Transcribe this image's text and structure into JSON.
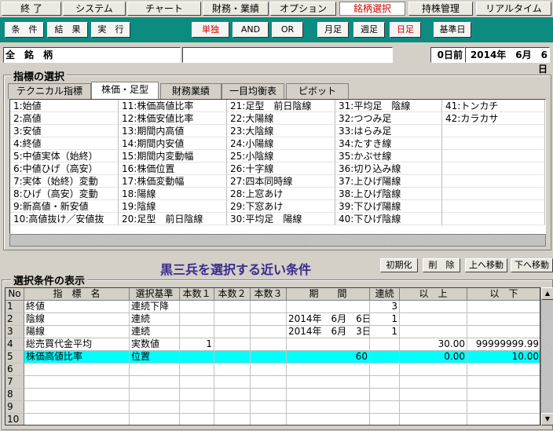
{
  "menu": [
    {
      "label": "終 了",
      "active": false
    },
    {
      "label": "システム",
      "active": false
    },
    {
      "label": "チャート",
      "active": false
    },
    {
      "label": "財務・業績",
      "active": false
    },
    {
      "label": "オプション",
      "active": false
    },
    {
      "label": "銘柄選択",
      "active": true
    },
    {
      "label": "持株管理",
      "active": false
    },
    {
      "label": "リアルタイム",
      "active": false
    }
  ],
  "toolbar": {
    "buttons": [
      "条　件",
      "結　果",
      "実　行",
      "単独",
      "AND",
      "OR",
      "月足",
      "週足",
      "日足",
      "基準日"
    ],
    "red": [
      "単独",
      "日足"
    ]
  },
  "header": {
    "title": "全　銘　柄",
    "days": "0日前",
    "date": "2014年　6月　6日"
  },
  "indicator_section": {
    "legend": "指標の選択",
    "tabs": [
      "テクニカル指標",
      "株価・足型",
      "財務業績",
      "一目均衡表",
      "ピボット"
    ],
    "selected_tab": 1,
    "columns": [
      [
        "1:始値",
        "2:高値",
        "3:安値",
        "4:終値",
        "5:中値実体（始終）",
        "6:中値ひげ（高安）",
        "7:実体（始終）変動",
        "8:ひげ（高安）変動",
        "9:新高値・新安値",
        "10:高値抜け／安値抜"
      ],
      [
        "11:株価高値比率",
        "12:株価安値比率",
        "13:期間内高値",
        "14:期間内安値",
        "15:期間内変動幅",
        "16:株価位置",
        "17:株価変動幅",
        "18:陽線",
        "19:陰線",
        "20:足型　前日陰線"
      ],
      [
        "21:足型　前日陰線",
        "22:大陽線",
        "23:大陰線",
        "24:小陽線",
        "25:小陰線",
        "26:十字線",
        "27:四本同時線",
        "28:上窓あけ",
        "29:下窓あけ",
        "30:平均足　陽線"
      ],
      [
        "31:平均足　陰線",
        "32:つつみ足",
        "33:はらみ足",
        "34:たすき線",
        "35:かぶせ線",
        "36:切り込み線",
        "37:上ひげ陽線",
        "38:上ひげ陰線",
        "39:下ひげ陽線",
        "40:下ひげ陰線"
      ],
      [
        "41:トンカチ",
        "42:カラカサ",
        "",
        "",
        "",
        "",
        "",
        "",
        "",
        ""
      ]
    ]
  },
  "caption": "黒三兵を選択する近い条件",
  "side_buttons": [
    "初期化",
    "削　除",
    "上へ移動",
    "下へ移動"
  ],
  "conditions": {
    "legend": "選択条件の表示",
    "headers": [
      "No",
      "指　標　名",
      "選択基準",
      "本数１",
      "本数２",
      "本数３",
      "期　　間",
      "連続",
      "以　上",
      "以　下"
    ],
    "rows": [
      {
        "no": "1",
        "name": "終値",
        "basis": "連続下降",
        "n1": "",
        "n2": "",
        "n3": "",
        "period": "",
        "cont": "3",
        "ge": "",
        "le": "",
        "hl": false
      },
      {
        "no": "2",
        "name": "陰線",
        "basis": "連続",
        "n1": "",
        "n2": "",
        "n3": "",
        "period": "2014年　6月　6日",
        "cont": "1",
        "ge": "",
        "le": "",
        "hl": false
      },
      {
        "no": "3",
        "name": "陽線",
        "basis": "連続",
        "n1": "",
        "n2": "",
        "n3": "",
        "period": "2014年　6月　3日",
        "cont": "1",
        "ge": "",
        "le": "",
        "hl": false
      },
      {
        "no": "4",
        "name": "総売買代金平均",
        "basis": "実数値",
        "n1": "1",
        "n2": "",
        "n3": "",
        "period": "",
        "cont": "",
        "ge": "30.00",
        "le": "99999999.99",
        "hl": false
      },
      {
        "no": "5",
        "name": "株価高値比率",
        "basis": "位置",
        "n1": "",
        "n2": "",
        "n3": "",
        "period": "60",
        "cont": "",
        "ge": "0.00",
        "le": "10.00",
        "hl": true
      },
      {
        "no": "6",
        "name": "",
        "basis": "",
        "n1": "",
        "n2": "",
        "n3": "",
        "period": "",
        "cont": "",
        "ge": "",
        "le": "",
        "hl": false
      },
      {
        "no": "7",
        "name": "",
        "basis": "",
        "n1": "",
        "n2": "",
        "n3": "",
        "period": "",
        "cont": "",
        "ge": "",
        "le": "",
        "hl": false
      },
      {
        "no": "8",
        "name": "",
        "basis": "",
        "n1": "",
        "n2": "",
        "n3": "",
        "period": "",
        "cont": "",
        "ge": "",
        "le": "",
        "hl": false
      },
      {
        "no": "9",
        "name": "",
        "basis": "",
        "n1": "",
        "n2": "",
        "n3": "",
        "period": "",
        "cont": "",
        "ge": "",
        "le": "",
        "hl": false
      },
      {
        "no": "10",
        "name": "",
        "basis": "",
        "n1": "",
        "n2": "",
        "n3": "",
        "period": "",
        "cont": "",
        "ge": "",
        "le": "",
        "hl": false
      }
    ]
  },
  "colors": {
    "toolbar": "#0c8c80",
    "highlight": "#00ffff",
    "caption": "#3a2a8c",
    "active_red": "#d00000"
  }
}
